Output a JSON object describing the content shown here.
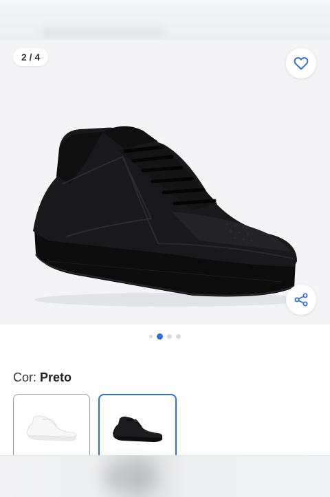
{
  "gallery": {
    "counter": "2 / 4",
    "image_alt": "Tênis preto",
    "current_index": 2,
    "total": 4
  },
  "favorite_icon": "heart-icon",
  "share_icon": "share-icon",
  "color_selector": {
    "label": "Cor:",
    "value": "Preto",
    "options": [
      {
        "name": "Branco",
        "selected": false
      },
      {
        "name": "Preto",
        "selected": true
      }
    ]
  },
  "colors": {
    "accent": "#2f6fdc",
    "gallery_bg": "#f4f4f6"
  }
}
